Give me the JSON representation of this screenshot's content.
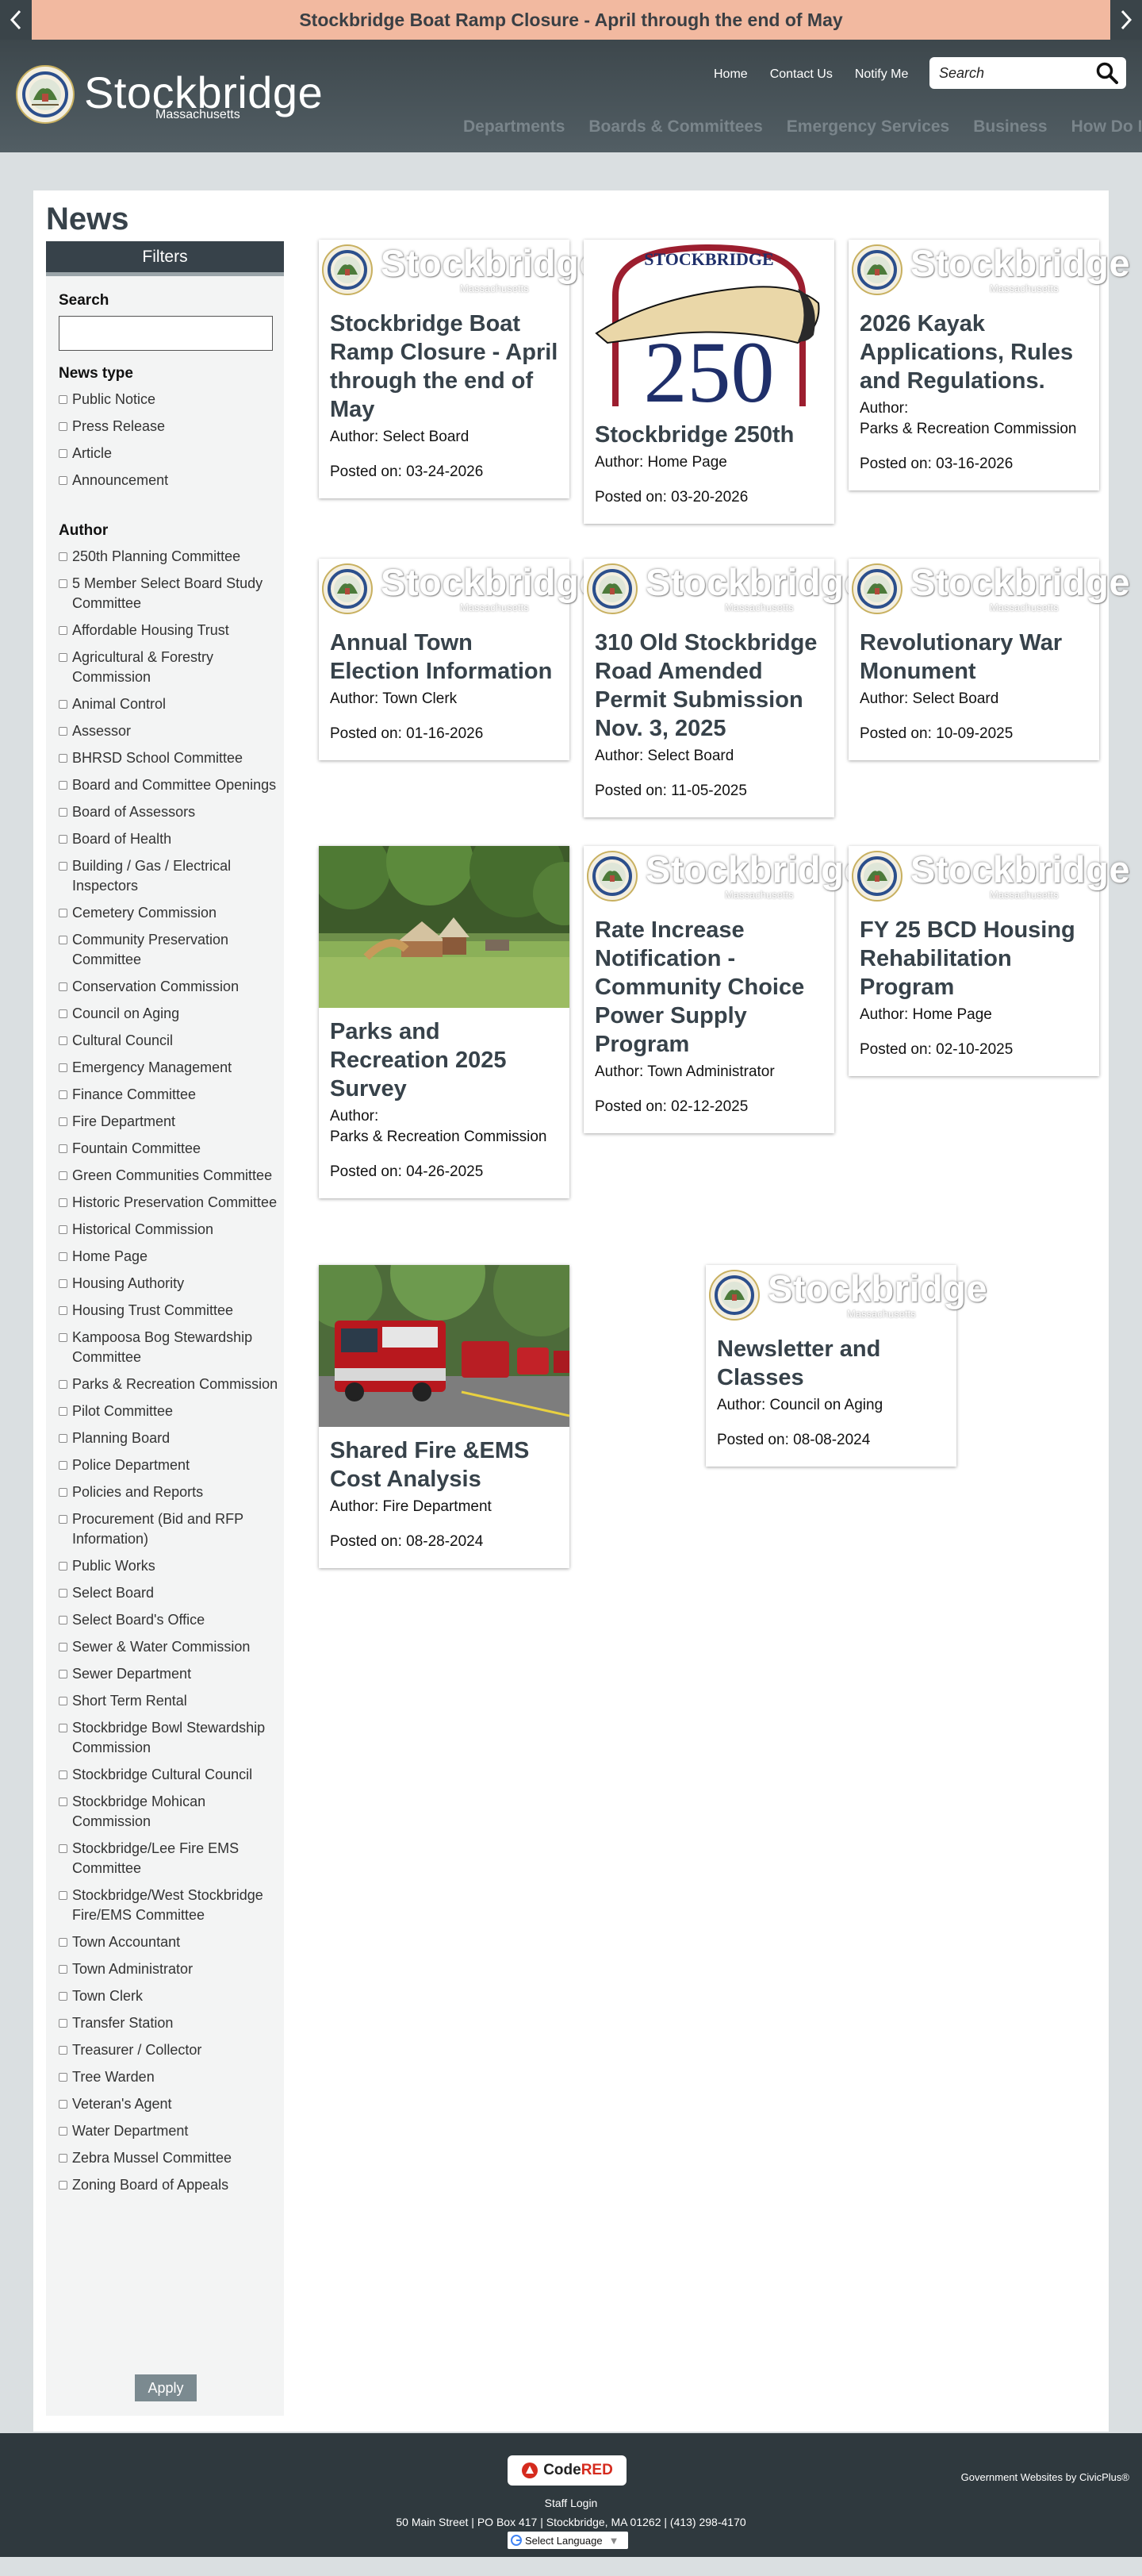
{
  "alert": {
    "text": "Stockbridge Boat Ramp Closure - April through the end of May"
  },
  "header": {
    "logo_text": "Stockbridge",
    "logo_sub": "Massachusetts",
    "top_links": [
      "Home",
      "Contact Us",
      "Notify Me"
    ],
    "search_placeholder": "Search",
    "nav": [
      "Departments",
      "Boards & Committees",
      "Emergency Services",
      "Business",
      "How Do I"
    ]
  },
  "page": {
    "title": "News"
  },
  "sidebar": {
    "filters_label": "Filters",
    "search_label": "Search",
    "search_value": "",
    "news_type_label": "News type",
    "news_types": [
      "Public Notice",
      "Press Release",
      "Article",
      "Announcement"
    ],
    "author_label": "Author",
    "authors": [
      "250th Planning Committee",
      "5 Member Select Board Study Committee",
      "Affordable Housing Trust",
      "Agricultural & Forestry Commission",
      "Animal Control",
      "Assessor",
      "BHRSD School Committee",
      "Board and Committee Openings",
      "Board of Assessors",
      "Board of Health",
      "Building / Gas / Electrical Inspectors",
      "Cemetery Commission",
      "Community Preservation Committee",
      "Conservation Commission",
      "Council on Aging",
      "Cultural Council",
      "Emergency Management",
      "Finance Committee",
      "Fire Department",
      "Fountain Committee",
      "Green Communities Committee",
      "Historic Preservation Committee",
      "Historical Commission",
      "Home Page",
      "Housing Authority",
      "Housing Trust Committee",
      "Kampoosa Bog Stewardship Committee",
      "Parks & Recreation Commission",
      "Pilot Committee",
      "Planning Board",
      "Police Department",
      "Policies and Reports",
      "Procurement (Bid and RFP Information)",
      "Public Works",
      "Select Board",
      "Select Board's Office",
      "Sewer & Water Commission",
      "Sewer Department",
      "Short Term Rental",
      "Stockbridge Bowl Stewardship Commission",
      "Stockbridge Cultural Council",
      "Stockbridge Mohican Commission",
      "Stockbridge/Lee Fire EMS Committee",
      "Stockbridge/West Stockbridge Fire/EMS Committee",
      "Town Accountant",
      "Town Administrator",
      "Town Clerk",
      "Transfer Station",
      "Treasurer / Collector",
      "Tree Warden",
      "Veteran's Agent",
      "Water Department",
      "Zebra Mussel Committee",
      "Zoning Board of Appeals"
    ],
    "apply_label": "Apply"
  },
  "cards": [
    {
      "title": "Stockbridge Boat Ramp Closure - April through the end of May",
      "author": "Author: Select Board",
      "posted": "Posted on: 03-24-2026",
      "image": "placeholder"
    },
    {
      "title": "Stockbridge 250th",
      "author": "Author: Home Page",
      "posted": "Posted on: 03-20-2026",
      "image": "250-logo",
      "img_text_top": "STOCKBRIDGE",
      "img_text_big": "250"
    },
    {
      "title": "2026 Kayak Applications, Rules and Regulations.",
      "author": "Author:",
      "author2": "Parks & Recreation Commission",
      "posted": "Posted on: 03-16-2026",
      "image": "placeholder"
    },
    {
      "title": "Annual Town Election Information",
      "author": "Author: Town Clerk",
      "posted": "Posted on: 01-16-2026",
      "image": "placeholder"
    },
    {
      "title": "310 Old Stockbridge Road Amended Permit Submission Nov. 3, 2025",
      "author": "Author: Select Board",
      "posted": "Posted on: 11-05-2025",
      "image": "placeholder"
    },
    {
      "title": "Revolutionary War Monument",
      "author": "Author: Select Board",
      "posted": "Posted on: 10-09-2025",
      "image": "placeholder"
    },
    {
      "title": "Parks and Recreation 2025 Survey",
      "author": "Author:",
      "author2": "Parks & Recreation Commission",
      "posted": "Posted on: 04-26-2025",
      "image": "playground-photo"
    },
    {
      "title": "Rate Increase Notification - Community Choice Power Supply Program",
      "author": "Author: Town Administrator",
      "posted": "Posted on: 02-12-2025",
      "image": "placeholder"
    },
    {
      "title": "FY 25 BCD Housing Rehabilitation Program",
      "author": "Author: Home Page",
      "posted": "Posted on: 02-10-2025",
      "image": "placeholder"
    },
    {
      "title": "Shared Fire &EMS Cost Analysis",
      "author": "Author: Fire Department",
      "posted": "Posted on: 08-28-2024",
      "image": "fire-truck-photo"
    },
    {
      "title": "Newsletter and Classes",
      "author": "Author: Council on Aging",
      "posted": "Posted on: 08-08-2024",
      "image": "placeholder"
    }
  ],
  "placeholder_image": {
    "word": "Stockbridge",
    "sub": "Massachusetts"
  },
  "footer": {
    "codered_a": "Code",
    "codered_b": "RED",
    "staff_login": "Staff Login",
    "address": "50 Main Street | PO Box 417 | Stockbridge, MA 01262 | (413) 298-4170",
    "language": "Select Language",
    "language_arrow": "▼",
    "credit": "Government Websites by CivicPlus®"
  },
  "colors": {
    "alert_bg": "#f2b9a0",
    "header_bg": "#3d474c",
    "title": "#37424a",
    "footer_bg": "#2f393e"
  }
}
